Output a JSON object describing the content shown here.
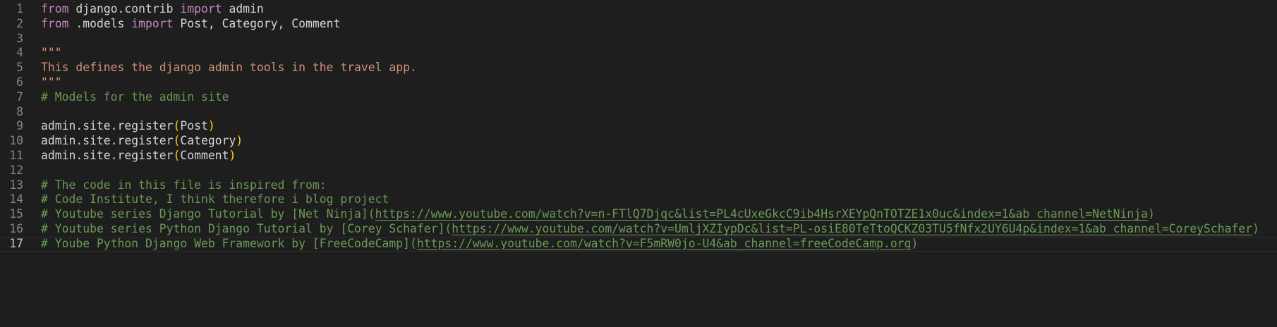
{
  "editor": {
    "lines": [
      {
        "num": "1",
        "parts": [
          {
            "t": "from",
            "c": "kw"
          },
          {
            "t": " django.contrib ",
            "c": ""
          },
          {
            "t": "import",
            "c": "kw"
          },
          {
            "t": " admin",
            "c": ""
          }
        ]
      },
      {
        "num": "2",
        "parts": [
          {
            "t": "from",
            "c": "kw"
          },
          {
            "t": " .models ",
            "c": ""
          },
          {
            "t": "import",
            "c": "kw"
          },
          {
            "t": " Post, Category, Comment",
            "c": ""
          }
        ]
      },
      {
        "num": "3",
        "parts": []
      },
      {
        "num": "4",
        "parts": [
          {
            "t": "\"\"\"",
            "c": "str"
          }
        ]
      },
      {
        "num": "5",
        "parts": [
          {
            "t": "This defines the django admin tools in the travel app.",
            "c": "str"
          }
        ]
      },
      {
        "num": "6",
        "parts": [
          {
            "t": "\"\"\"",
            "c": "str"
          }
        ]
      },
      {
        "num": "7",
        "parts": [
          {
            "t": "# Models for the admin site",
            "c": "cm"
          }
        ]
      },
      {
        "num": "8",
        "parts": []
      },
      {
        "num": "9",
        "parts": [
          {
            "t": "admin.site.register",
            "c": ""
          },
          {
            "t": "(",
            "c": "br"
          },
          {
            "t": "Post",
            "c": ""
          },
          {
            "t": ")",
            "c": "br"
          }
        ]
      },
      {
        "num": "10",
        "parts": [
          {
            "t": "admin.site.register",
            "c": ""
          },
          {
            "t": "(",
            "c": "br"
          },
          {
            "t": "Category",
            "c": ""
          },
          {
            "t": ")",
            "c": "br"
          }
        ]
      },
      {
        "num": "11",
        "parts": [
          {
            "t": "admin.site.register",
            "c": ""
          },
          {
            "t": "(",
            "c": "br"
          },
          {
            "t": "Comment",
            "c": ""
          },
          {
            "t": ")",
            "c": "br"
          }
        ]
      },
      {
        "num": "12",
        "parts": []
      },
      {
        "num": "13",
        "parts": [
          {
            "t": "# The code in this file is inspired from:",
            "c": "cm"
          }
        ]
      },
      {
        "num": "14",
        "parts": [
          {
            "t": "# Code Institute, I think therefore i blog project",
            "c": "cm"
          }
        ]
      },
      {
        "num": "15",
        "parts": [
          {
            "t": "# Youtube series Django Tutorial by [Net Ninja](",
            "c": "cm"
          },
          {
            "t": "https://www.youtube.com/watch?v=n-FTlQ7Djqc&list=PL4cUxeGkcC9ib4HsrXEYpQnTOTZE1x0uc&index=1&ab_channel=NetNinja",
            "c": "cm link"
          },
          {
            "t": ")",
            "c": "cm"
          }
        ]
      },
      {
        "num": "16",
        "parts": [
          {
            "t": "# Youtube series Python Django Tutorial by [Corey Schafer](",
            "c": "cm"
          },
          {
            "t": "https://www.youtube.com/watch?v=UmljXZIypDc&list=PL-osiE80TeTtoQCKZ03TU5fNfx2UY6U4p&index=1&ab_channel=CoreySchafer",
            "c": "cm link"
          },
          {
            "t": ")",
            "c": "cm"
          }
        ]
      },
      {
        "num": "17",
        "active": true,
        "parts": [
          {
            "t": "# Yoube Python Django Web Framework by [FreeCodeCamp](",
            "c": "cm"
          },
          {
            "t": "https://www.youtube.com/watch?v=F5mRW0jo-U4&ab_channel=freeCodeCamp.org",
            "c": "cm link"
          },
          {
            "t": ")",
            "c": "cm"
          }
        ]
      }
    ]
  },
  "colors": {
    "background": "#1e1e1e",
    "keyword": "#c586c0",
    "string": "#ce9178",
    "comment": "#6a9955",
    "bracket": "#ffd700",
    "text": "#d4d4d4",
    "line_number": "#858585"
  }
}
